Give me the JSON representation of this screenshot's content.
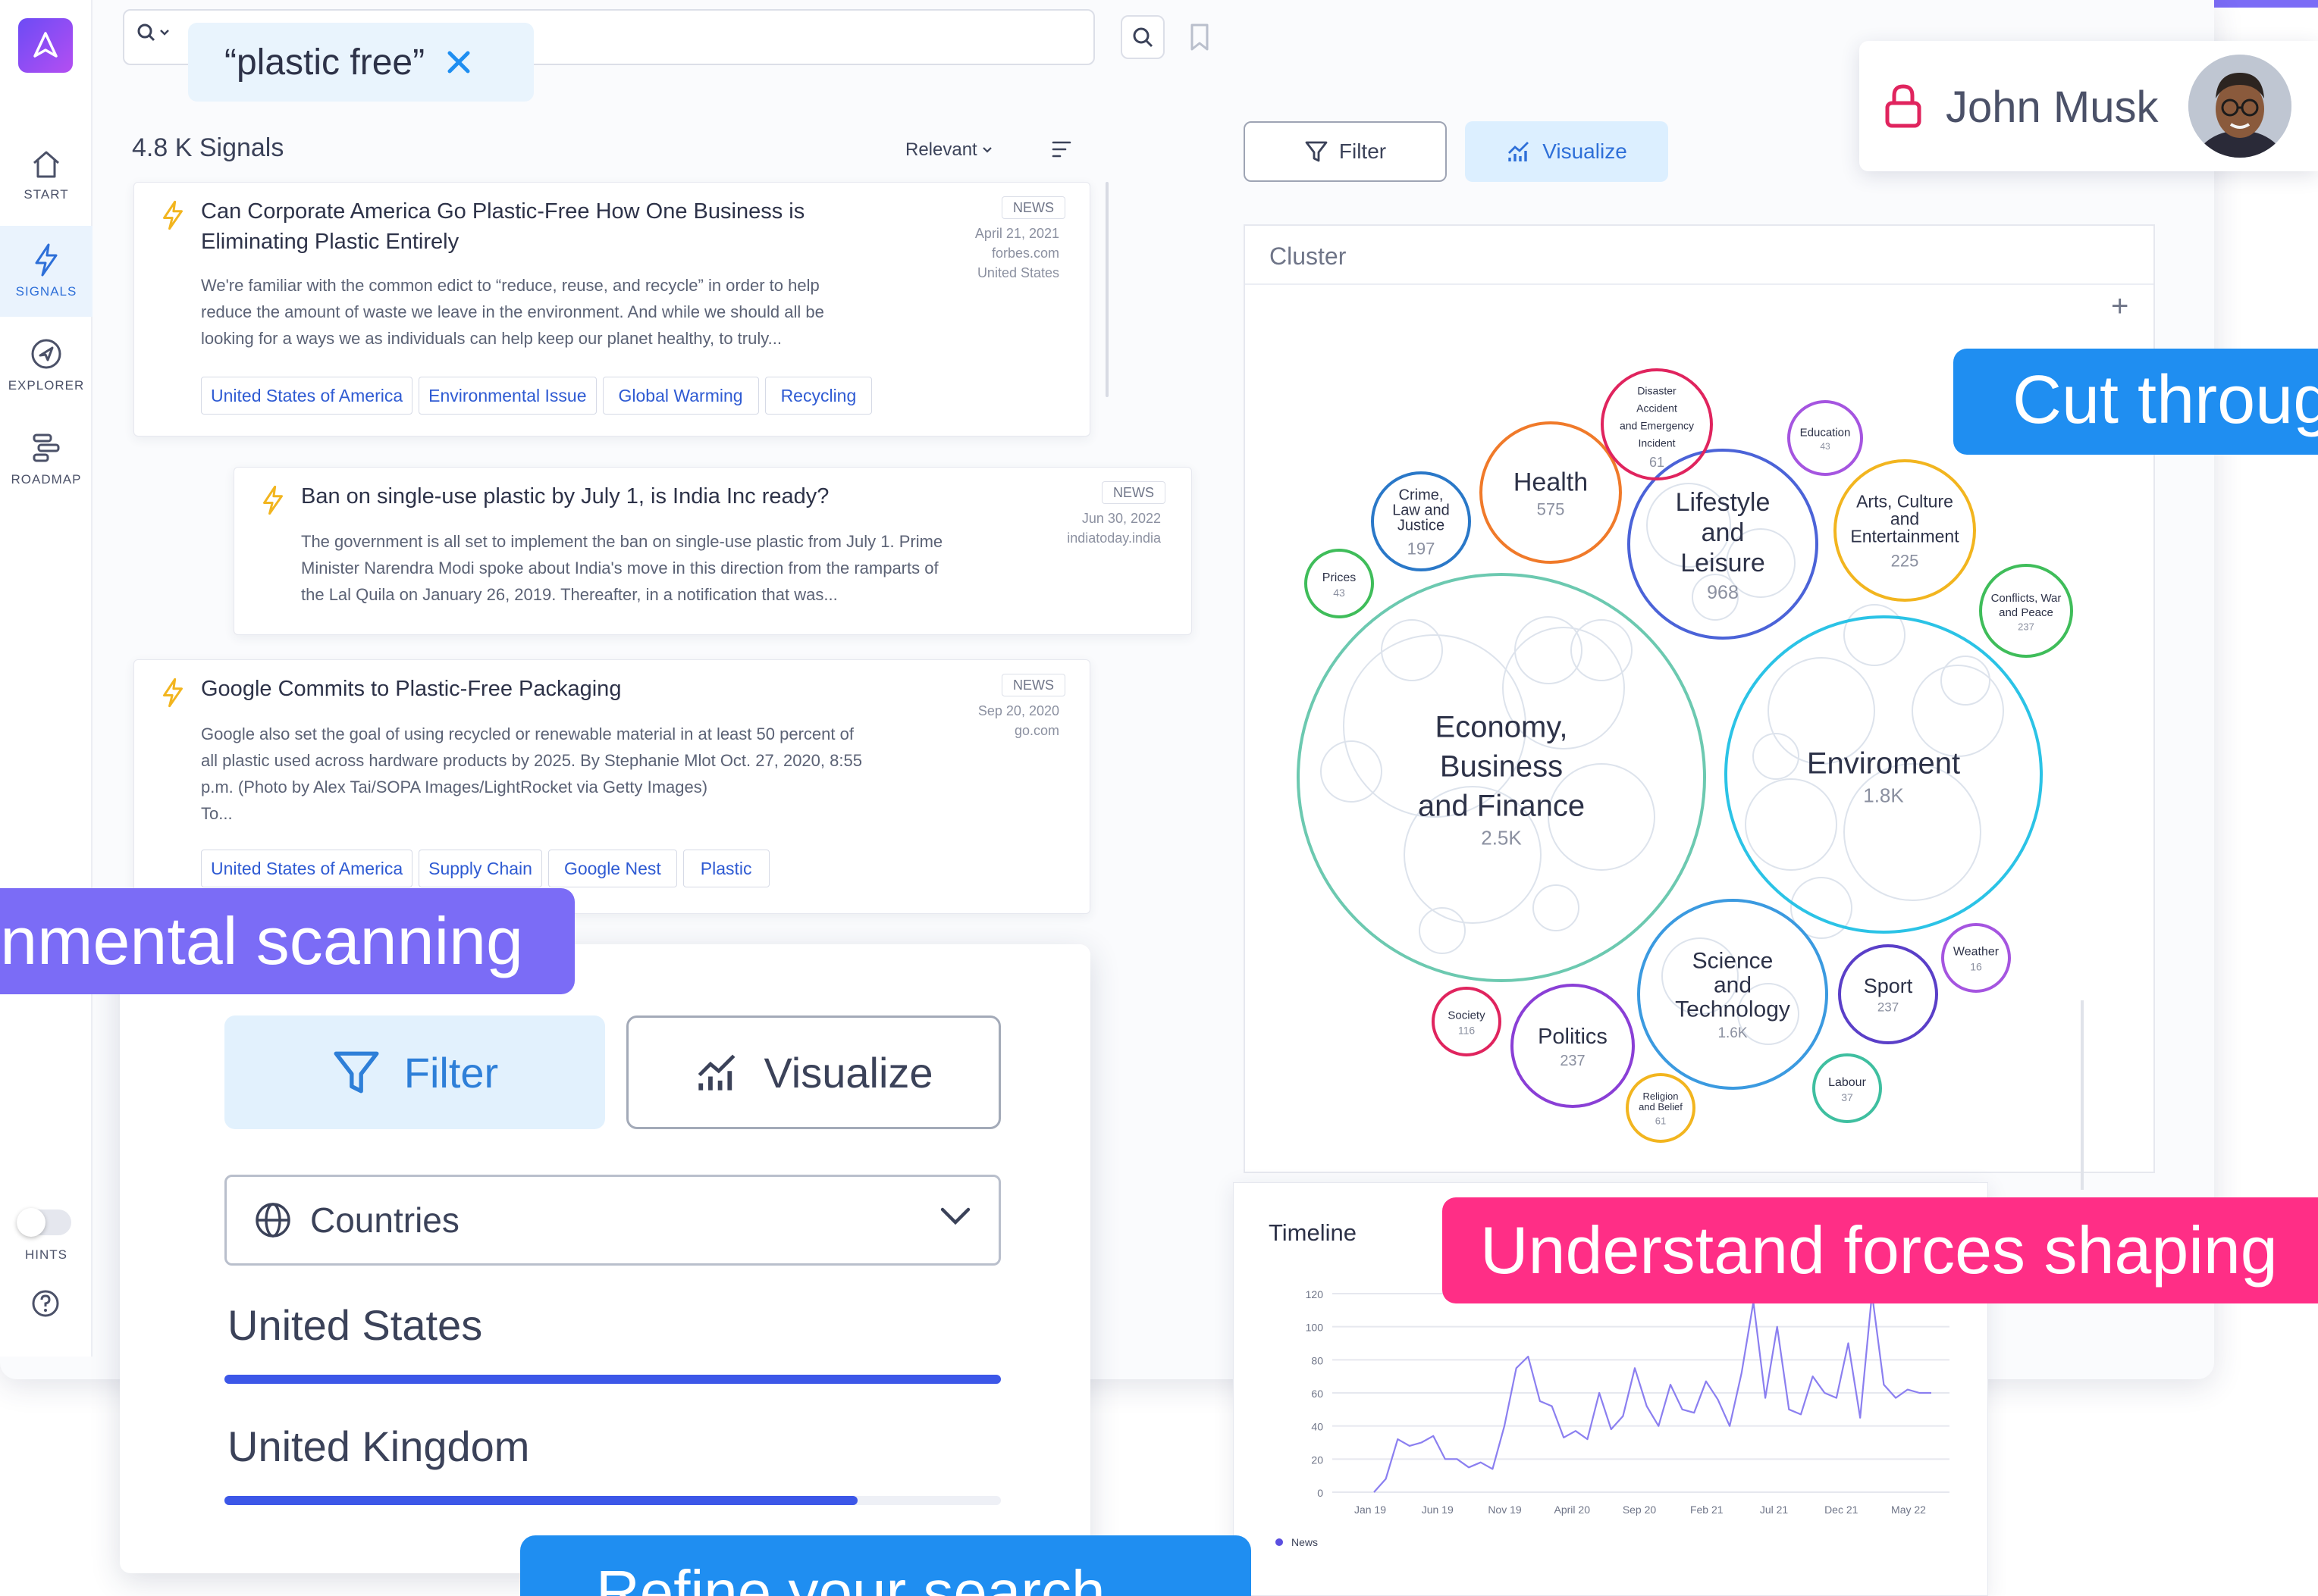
{
  "colors": {
    "accent_blue": "#2e6fd8",
    "tag_blue": "#2f5bd3",
    "bar_blue": "#3c57e8",
    "banner_purple": "#7b6cf6",
    "banner_pink": "#ff2e86",
    "banner_blue": "#1f8ef1",
    "bolt_yellow": "#f2b51f"
  },
  "sidebar": {
    "items": [
      {
        "label": "START",
        "icon": "home-icon"
      },
      {
        "label": "SIGNALS",
        "icon": "bolt-icon",
        "active": true
      },
      {
        "label": "EXPLORER",
        "icon": "compass-icon"
      },
      {
        "label": "ROADMAP",
        "icon": "roadmap-icon"
      }
    ],
    "hints_label": "HINTS",
    "hints_on": false
  },
  "search": {
    "chip_text": "“plastic free”",
    "value": ""
  },
  "signals": {
    "count_label": "4.8 K Signals",
    "sort_label": "Relevant",
    "cards": [
      {
        "title_line1": "Can Corporate America Go Plastic-Free How One Business is",
        "title_line2": "Eliminating Plastic Entirely",
        "body_line1": "We're familiar with the common edict to “reduce, reuse, and recycle” in order to help",
        "body_line2": "reduce the amount of waste we leave in the environment. And while we should all be",
        "body_line3": "looking for a ways we as individuals can help keep our planet healthy, to truly...",
        "badge": "NEWS",
        "date": "April 21, 2021",
        "source": "forbes.com",
        "country": "United States",
        "tags": [
          "United States of America",
          "Environmental Issue",
          "Global Warming",
          "Recycling"
        ]
      },
      {
        "title_line1": "Ban on single-use plastic by July 1, is India Inc ready?",
        "body_line1": "The government is all set to implement the ban on single-use plastic from July 1. Prime",
        "body_line2": "Minister Narendra Modi spoke about India's move in this direction from the ramparts of",
        "body_line3": "the Lal Quila on January 26, 2019. Thereafter, in a notification that was...",
        "badge": "NEWS",
        "date": "Jun 30, 2022",
        "source": "indiatoday.india"
      },
      {
        "title_line1": "Google Commits to Plastic-Free Packaging",
        "body_line1": "Google also set the goal of using recycled or renewable material in at least 50 percent of",
        "body_line2": "all plastic used across hardware products by 2025. By Stephanie Mlot Oct. 27, 2020, 8:55",
        "body_line3": "p.m. (Photo by Alex Tai/SOPA Images/LightRocket via Getty Images)",
        "body_line4": "To...",
        "badge": "NEWS",
        "date": "Sep 20, 2020",
        "source": "go.com",
        "tags": [
          "United States of America",
          "Supply Chain",
          "Google Nest",
          "Plastic"
        ]
      }
    ]
  },
  "toolbar": {
    "filter_label": "Filter",
    "visualize_label": "Visualize"
  },
  "user": {
    "name": "John Musk"
  },
  "cluster": {
    "title": "Cluster",
    "plus": "+",
    "bubbles": [
      {
        "lines": [
          "Economy,",
          "Business",
          "and Finance"
        ],
        "count": "2.5K",
        "color": "#6cc9b0",
        "size": "xl"
      },
      {
        "lines": [
          "Enviroment"
        ],
        "count": "1.8K",
        "color": "#2bc3e6",
        "size": "xl"
      },
      {
        "lines": [
          "Lifestyle",
          "and",
          "Leisure"
        ],
        "count": "968",
        "color": "#4b63d8",
        "size": "l"
      },
      {
        "lines": [
          "Science",
          "and",
          "Technology"
        ],
        "count": "1.6K",
        "color": "#3b9ae0",
        "size": "l"
      },
      {
        "lines": [
          "Health"
        ],
        "count": "575",
        "color": "#f07a2a",
        "size": "m"
      },
      {
        "lines": [
          "Arts, Culture",
          "and",
          "Entertainment"
        ],
        "count": "225",
        "color": "#f2b51f",
        "size": "m"
      },
      {
        "lines": [
          "Politics"
        ],
        "count": "237",
        "color": "#8a3fd6",
        "size": "m"
      },
      {
        "lines": [
          "Sport"
        ],
        "count": "237",
        "color": "#5a3fc8",
        "size": "s"
      },
      {
        "lines": [
          "Crime,",
          "Law and",
          "Justice"
        ],
        "count": "197",
        "color": "#2a78c8",
        "size": "s"
      },
      {
        "lines": [
          "Disaster",
          "Accident",
          "and Emergency",
          "Incident"
        ],
        "count": "61",
        "color": "#e0245e",
        "size": "xs"
      },
      {
        "lines": [
          "Education"
        ],
        "count": "43",
        "color": "#a555e0",
        "size": "xs"
      },
      {
        "lines": [
          "Conflicts, War",
          "and Peace"
        ],
        "count": "237",
        "color": "#3fbd5a",
        "size": "xs"
      },
      {
        "lines": [
          "Prices"
        ],
        "count": "43",
        "color": "#3fbd5a",
        "size": "xs"
      },
      {
        "lines": [
          "Society"
        ],
        "count": "116",
        "color": "#e0245e",
        "size": "xs"
      },
      {
        "lines": [
          "Weather"
        ],
        "count": "16",
        "color": "#a555e0",
        "size": "xs"
      },
      {
        "lines": [
          "Labour"
        ],
        "count": "37",
        "color": "#3fbfa0",
        "size": "xs"
      },
      {
        "lines": [
          "Religion",
          "and Belief"
        ],
        "count": "61",
        "color": "#f2b51f",
        "size": "xs"
      }
    ]
  },
  "timeline": {
    "title": "Timeline",
    "legend": "News"
  },
  "chart_data": {
    "type": "line",
    "title": "Timeline",
    "xlabel": "",
    "ylabel": "",
    "ylim": [
      0,
      120
    ],
    "yticks": [
      0,
      20,
      40,
      60,
      80,
      100,
      120
    ],
    "x_tick_labels": [
      "Jan 19",
      "Jun 19",
      "Nov 19",
      "April 20",
      "Sep 20",
      "Feb 21",
      "Jul 21",
      "Dec 21",
      "May 22"
    ],
    "grid": true,
    "legend_position": "bottom-left",
    "series": [
      {
        "name": "News",
        "color": "#8b7ff0",
        "values": [
          0,
          8,
          32,
          28,
          30,
          34,
          20,
          20,
          15,
          18,
          14,
          40,
          75,
          82,
          55,
          52,
          33,
          37,
          32,
          60,
          38,
          46,
          75,
          52,
          40,
          65,
          50,
          48,
          67,
          56,
          40,
          72,
          115,
          57,
          100,
          50,
          47,
          70,
          60,
          57,
          90,
          45,
          120,
          65,
          57,
          62,
          60,
          60
        ]
      }
    ]
  },
  "filter_panel": {
    "filter_label": "Filter",
    "visualize_label": "Visualize",
    "select_label": "Countries",
    "countries": [
      {
        "name": "United States",
        "share": 1.0
      },
      {
        "name": "United Kingdom",
        "share": 0.815
      }
    ]
  },
  "banners": {
    "left_purple": "nmental scanning",
    "top_blue": "Cut throug",
    "pink": "Understand forces shaping",
    "bottom_blue": "Refine your search"
  }
}
